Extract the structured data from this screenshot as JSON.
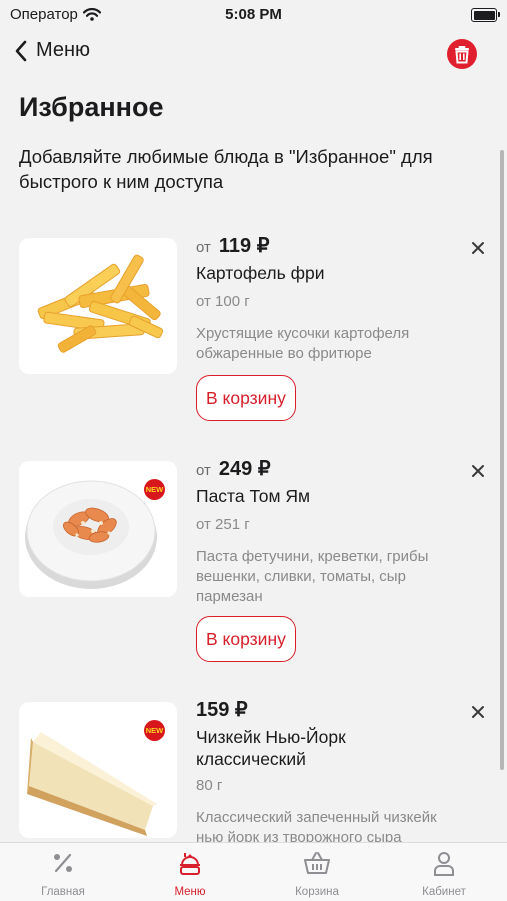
{
  "status": {
    "carrier": "Оператор",
    "time": "5:08 PM",
    "battery_level": 1.0
  },
  "nav": {
    "back_label": "Меню"
  },
  "page": {
    "title": "Избранное",
    "subtitle": "Добавляйте любимые блюда в \"Избранное\" для быстрого к ним доступа"
  },
  "items": [
    {
      "price_prefix": "от",
      "price": "119 ₽",
      "name": "Картофель фри",
      "weight": "от 100 г",
      "description": "Хрустящие кусочки картофеля обжаренные во фритюре",
      "cart_label": "В корзину",
      "badge": ""
    },
    {
      "price_prefix": "от",
      "price": "249 ₽",
      "name": "Паста Том Ям",
      "weight": "от 251 г",
      "description": "Паста фетучини, креветки, грибы вешенки, сливки, томаты, сыр пармезан",
      "cart_label": "В корзину",
      "badge": "NEW"
    },
    {
      "price_prefix": "",
      "price": "159 ₽",
      "name": "Чизкейк Нью-Йорк классический",
      "weight": "80 г",
      "description": "Классический запеченный чизкейк нью йорк из творожного сыра",
      "badge": "NEW"
    }
  ],
  "tabbar": {
    "tabs": [
      {
        "label": "Главная",
        "icon": "percent-icon",
        "active": false
      },
      {
        "label": "Меню",
        "icon": "menu-icon",
        "active": true
      },
      {
        "label": "Корзина",
        "icon": "basket-icon",
        "active": false
      },
      {
        "label": "Кабинет",
        "icon": "profile-icon",
        "active": false
      }
    ]
  },
  "colors": {
    "accent": "#d7202c",
    "background": "#f2f2f2",
    "muted": "#8a8a8a"
  }
}
